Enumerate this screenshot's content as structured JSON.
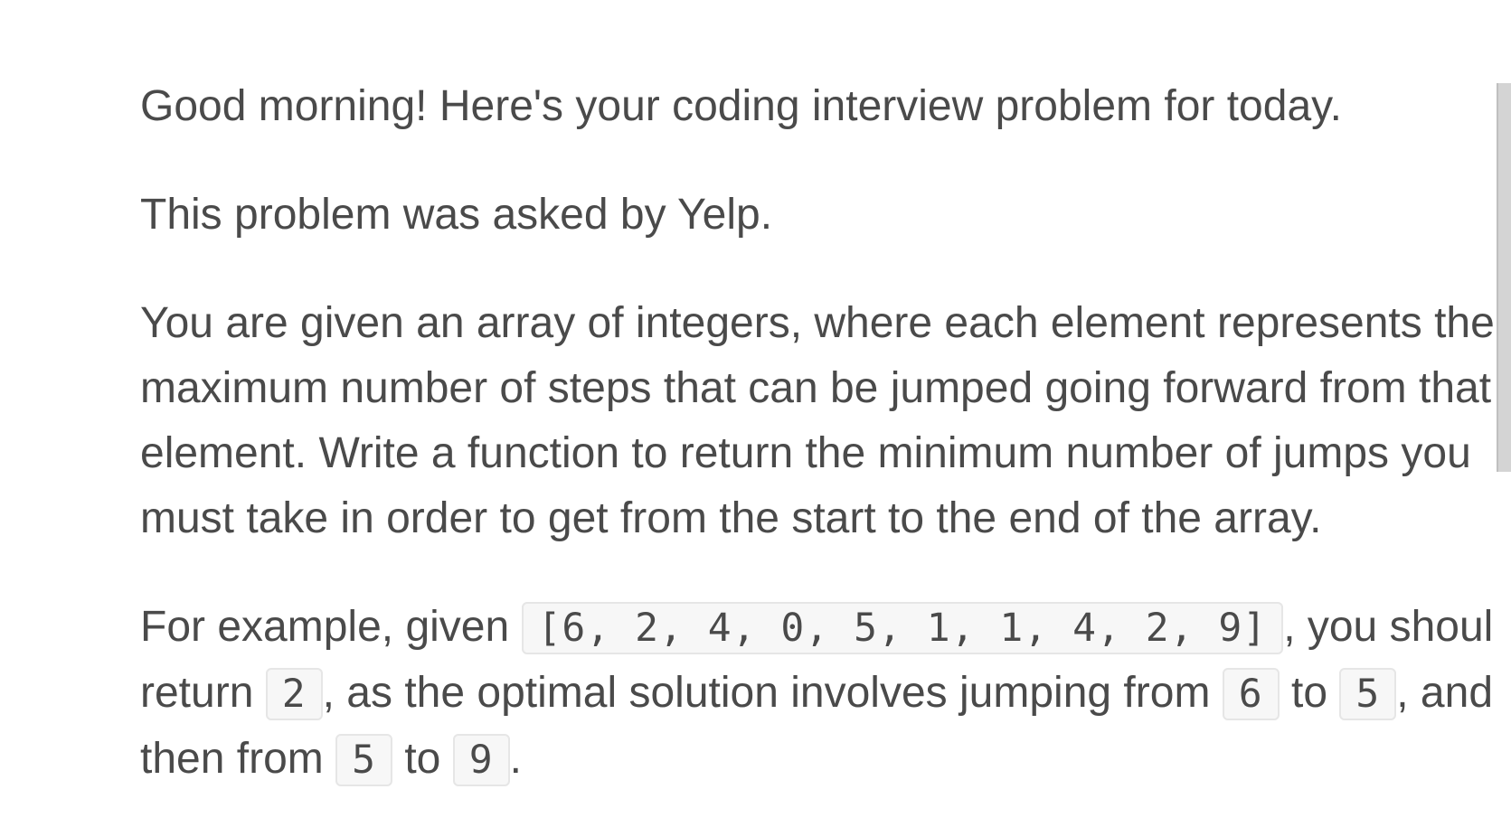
{
  "greeting": "Good morning! Here's your coding interview problem for today.",
  "source": "This problem was asked by Yelp.",
  "problem": "You are given an array of integers, where each element represents the maximum number of steps that can be jumped going forward from that element. Write a function to return the minimum number of jumps you must take in order to get from the start to the end of the array.",
  "example": {
    "t1": "For example, given ",
    "array": "[6, 2, 4, 0, 5, 1, 1, 4, 2, 9]",
    "t2": ", you should return ",
    "answer": "2",
    "t3": ", as the optimal solution involves jumping from ",
    "from1": "6",
    "t4": " to ",
    "to1": "5",
    "t5": ", and then from ",
    "from2": "5",
    "t6": " to ",
    "to2": "9",
    "t7": "."
  }
}
